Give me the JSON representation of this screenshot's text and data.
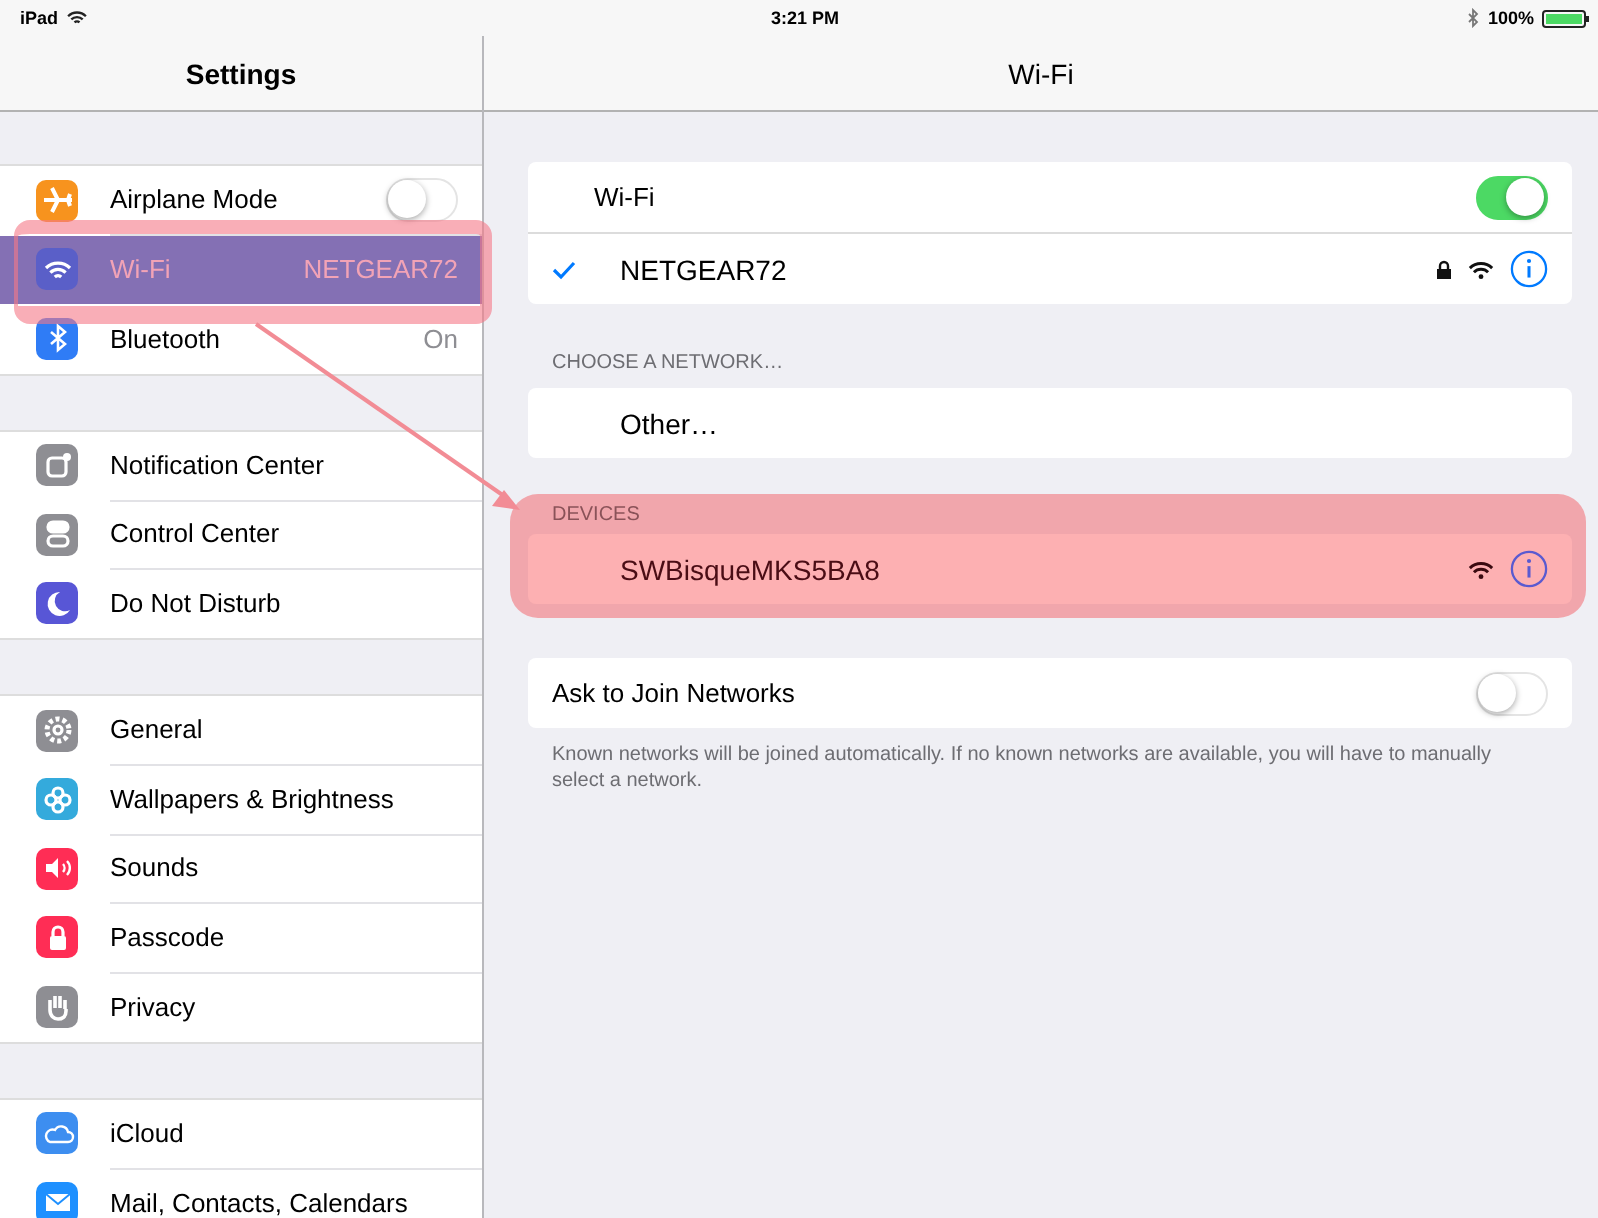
{
  "status_bar": {
    "device": "iPad",
    "time": "3:21 PM",
    "battery": "100%"
  },
  "sidebar": {
    "title": "Settings",
    "groups": [
      [
        {
          "label": "Airplane Mode",
          "kind": "airplane",
          "color": "#f7931e",
          "selected": false,
          "toggle_on": false
        },
        {
          "label": "Wi-Fi",
          "kind": "wifi",
          "color": "#5a5fc8",
          "selected": true,
          "value": "NETGEAR72"
        },
        {
          "label": "Bluetooth",
          "kind": "bluetooth",
          "color": "#2f7cf6",
          "selected": false,
          "value": "On"
        }
      ],
      [
        {
          "label": "Notification Center",
          "kind": "notification",
          "color": "#8e8e93",
          "selected": false
        },
        {
          "label": "Control Center",
          "kind": "switches",
          "color": "#8e8e93",
          "selected": false
        },
        {
          "label": "Do Not Disturb",
          "kind": "moon",
          "color": "#5856d6",
          "selected": false
        }
      ],
      [
        {
          "label": "General",
          "kind": "gear",
          "color": "#8e8e93",
          "selected": false
        },
        {
          "label": "Wallpapers & Brightness",
          "kind": "flower",
          "color": "#34aadc",
          "selected": false
        },
        {
          "label": "Sounds",
          "kind": "speaker",
          "color": "#ff2d55",
          "selected": false
        },
        {
          "label": "Passcode",
          "kind": "lock",
          "color": "#ff2d55",
          "selected": false
        },
        {
          "label": "Privacy",
          "kind": "hand",
          "color": "#8e8e93",
          "selected": false
        }
      ],
      [
        {
          "label": "iCloud",
          "kind": "cloud",
          "color": "#3d8ef0",
          "selected": false
        },
        {
          "label": "Mail, Contacts, Calendars",
          "kind": "envelope",
          "color": "#1e90ff",
          "selected": false
        }
      ]
    ]
  },
  "detail": {
    "title": "Wi-Fi",
    "wifi_label": "Wi-Fi",
    "wifi_on": true,
    "current_network": {
      "name": "NETGEAR72",
      "connected": true,
      "locked": true
    },
    "choose_header": "CHOOSE A NETWORK…",
    "other": "Other…",
    "devices_header": "DEVICES",
    "devices": [
      {
        "name": "SWBisqueMKS5BA8",
        "locked": false
      }
    ],
    "ask_label": "Ask to Join Networks",
    "ask_on": false,
    "footnote": "Known networks will be joined automatically. If no known networks are available, you will have to manually select a network."
  }
}
